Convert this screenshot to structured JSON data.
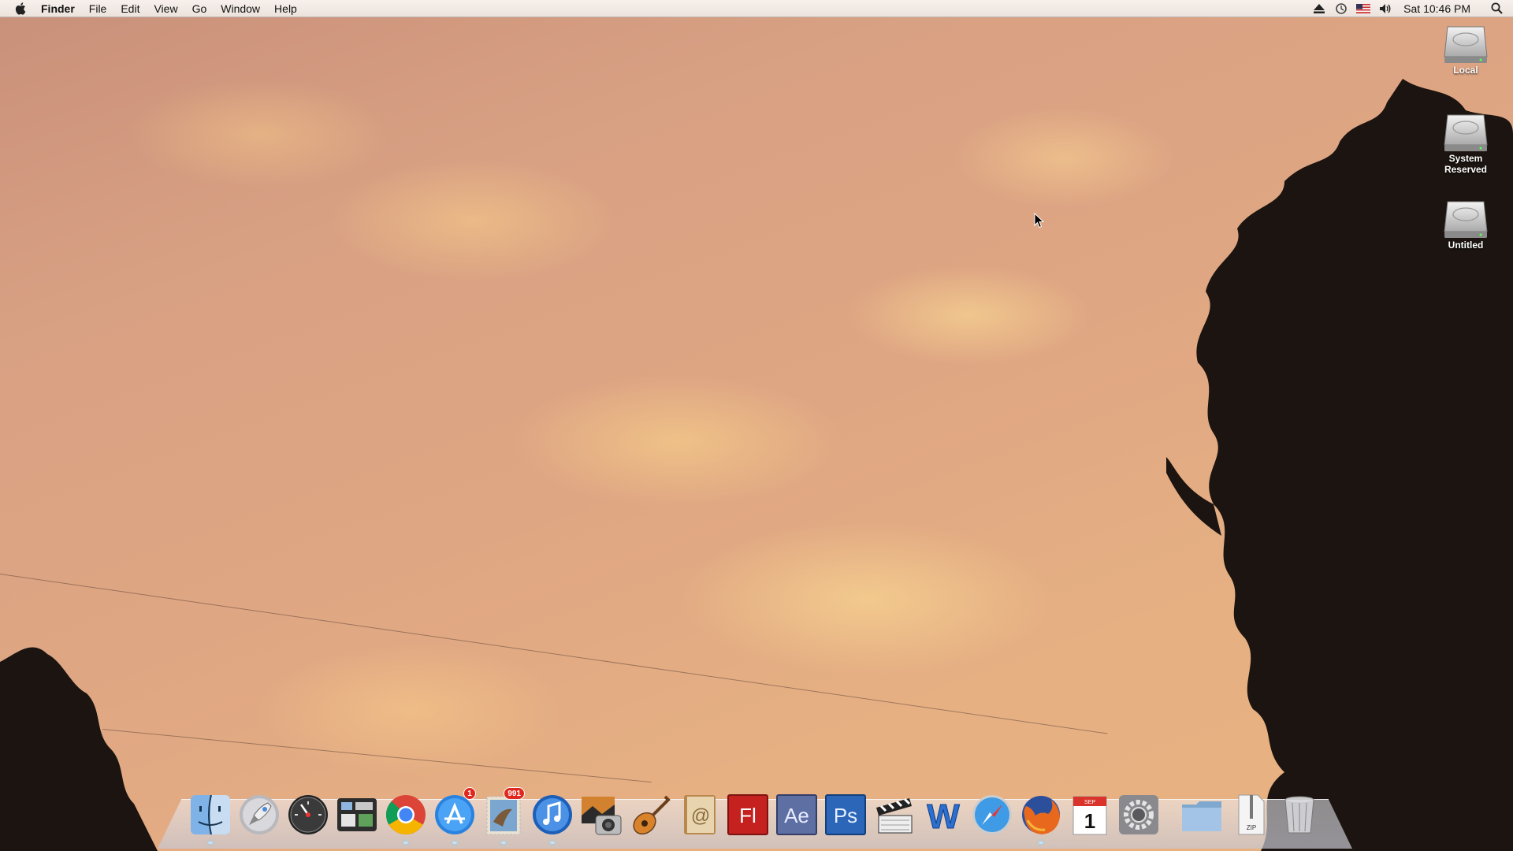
{
  "menubar": {
    "app_name": "Finder",
    "menus": [
      "File",
      "Edit",
      "View",
      "Go",
      "Window",
      "Help"
    ],
    "clock": "Sat 10:46 PM",
    "status_icons": [
      "eject-icon",
      "time-machine-icon",
      "us-flag-icon",
      "volume-icon",
      "spotlight-icon"
    ]
  },
  "desktop": {
    "icons": [
      {
        "label": "Local",
        "icon": "hard-drive-icon"
      },
      {
        "label": "System Reserved",
        "icon": "hard-drive-icon"
      },
      {
        "label": "Untitled",
        "icon": "hard-drive-icon"
      }
    ]
  },
  "dock": {
    "items": [
      {
        "name": "finder",
        "icon": "finder-icon"
      },
      {
        "name": "launchpad",
        "icon": "rocket-icon"
      },
      {
        "name": "dashboard",
        "icon": "speedometer-icon"
      },
      {
        "name": "mission-control",
        "icon": "mission-control-icon"
      },
      {
        "name": "chrome",
        "icon": "chrome-icon"
      },
      {
        "name": "app-store",
        "icon": "app-store-icon",
        "badge": "1"
      },
      {
        "name": "mail",
        "icon": "mail-stamp-icon",
        "badge": "991"
      },
      {
        "name": "itunes",
        "icon": "itunes-icon"
      },
      {
        "name": "photo-booth",
        "icon": "camera-icon"
      },
      {
        "name": "garageband",
        "icon": "guitar-icon"
      },
      {
        "name": "address-book",
        "icon": "address-book-icon"
      },
      {
        "name": "flash",
        "icon": "flash-icon",
        "text": "Fl"
      },
      {
        "name": "after-effects",
        "icon": "after-effects-icon",
        "text": "Ae"
      },
      {
        "name": "photoshop",
        "icon": "photoshop-icon",
        "text": "Ps"
      },
      {
        "name": "final-cut",
        "icon": "clapper-icon"
      },
      {
        "name": "word",
        "icon": "word-icon",
        "text": "W"
      },
      {
        "name": "safari",
        "icon": "compass-icon"
      },
      {
        "name": "firefox",
        "icon": "firefox-icon"
      },
      {
        "name": "ical",
        "icon": "calendar-icon",
        "month": "SEP",
        "day": "1"
      },
      {
        "name": "system-preferences",
        "icon": "gear-icon"
      }
    ],
    "stack_items": [
      {
        "name": "folder",
        "icon": "folder-icon"
      },
      {
        "name": "zip-file",
        "icon": "zip-file-icon",
        "text": "ZIP"
      },
      {
        "name": "trash",
        "icon": "trash-icon"
      }
    ]
  },
  "colors": {
    "sky_base": "#dfa683",
    "cloud_highlight": "#ffe296",
    "menubar_bg": "#f2e9e4",
    "badge_red": "#e0281e"
  }
}
